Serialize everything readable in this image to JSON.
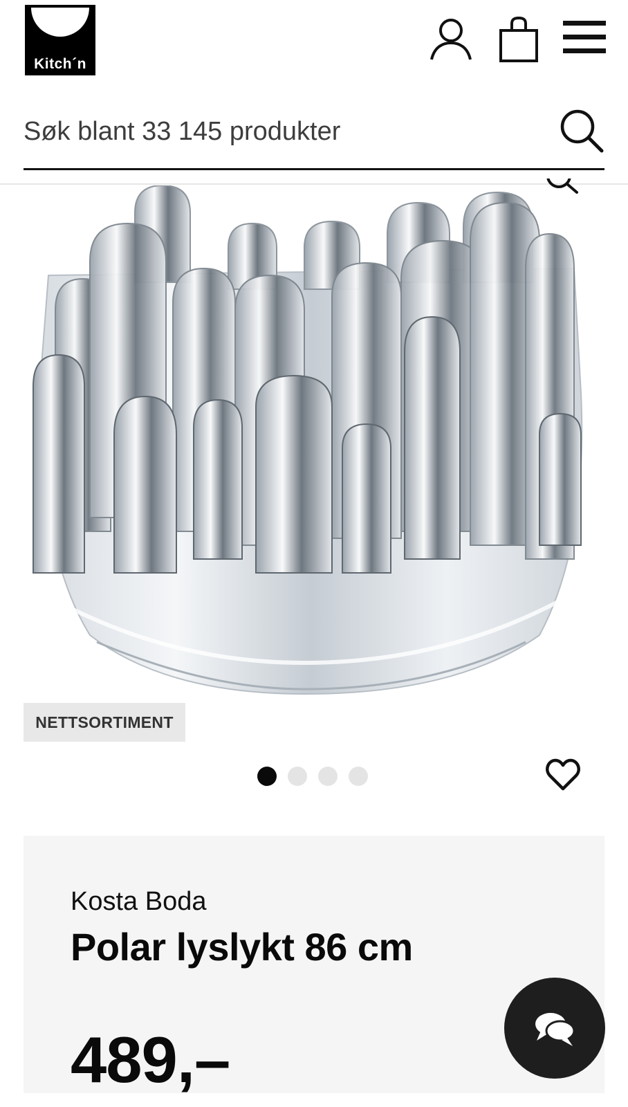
{
  "header": {
    "logo_text": "Kitch´n",
    "icons": [
      "user-icon",
      "shopping-bag-icon",
      "hamburger-menu-icon"
    ]
  },
  "search": {
    "placeholder": "Søk blant 33 145 produkter",
    "icon": "search-icon"
  },
  "product": {
    "badge": "NETTSORTIMENT",
    "image_count": 4,
    "active_image": 1,
    "brand": "Kosta Boda",
    "name": "Polar lyslykt 86 cm",
    "price": "489,–"
  },
  "actions": {
    "favorite_icon": "heart-icon",
    "chat_icon": "chat-bubbles-icon",
    "zoom_icon": "zoom-icon"
  },
  "colors": {
    "text": "#0a0a0a",
    "card_bg": "#f5f5f5",
    "badge_bg": "#e8e8e8",
    "dot_inactive": "#e4e4e4",
    "chat_bg": "#1e1e1e"
  }
}
